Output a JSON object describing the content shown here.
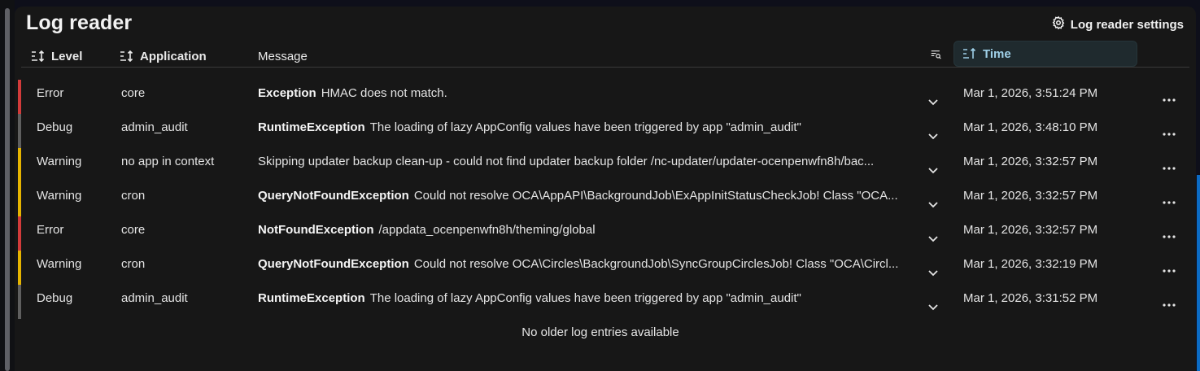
{
  "header": {
    "title": "Log reader",
    "settings_label": "Log reader settings"
  },
  "columns": {
    "level": "Level",
    "application": "Application",
    "message": "Message",
    "time": "Time"
  },
  "colors": {
    "error": "#d23b3b",
    "warning": "#e5b400",
    "debug": "#5f5f5f",
    "accent": "#9fd0e8"
  },
  "rows": [
    {
      "level": "Error",
      "app": "core",
      "exception": "Exception",
      "message": "HMAC does not match.",
      "time": "Mar 1, 2026, 3:51:24 PM"
    },
    {
      "level": "Debug",
      "app": "admin_audit",
      "exception": "RuntimeException",
      "message": "The loading of lazy AppConfig values have been triggered by app \"admin_audit\"",
      "time": "Mar 1, 2026, 3:48:10 PM"
    },
    {
      "level": "Warning",
      "app": "no app in context",
      "exception": "",
      "message": "Skipping updater backup clean-up - could not find updater backup folder /nc-updater/updater-ocenpenwfn8h/bac...",
      "time": "Mar 1, 2026, 3:32:57 PM"
    },
    {
      "level": "Warning",
      "app": "cron",
      "exception": "QueryNotFoundException",
      "message": "Could not resolve OCA\\AppAPI\\BackgroundJob\\ExAppInitStatusCheckJob! Class \"OCA...",
      "time": "Mar 1, 2026, 3:32:57 PM"
    },
    {
      "level": "Error",
      "app": "core",
      "exception": "NotFoundException",
      "message": "/appdata_ocenpenwfn8h/theming/global",
      "time": "Mar 1, 2026, 3:32:57 PM"
    },
    {
      "level": "Warning",
      "app": "cron",
      "exception": "QueryNotFoundException",
      "message": "Could not resolve OCA\\Circles\\BackgroundJob\\SyncGroupCirclesJob! Class \"OCA\\Circl...",
      "time": "Mar 1, 2026, 3:32:19 PM"
    },
    {
      "level": "Debug",
      "app": "admin_audit",
      "exception": "RuntimeException",
      "message": "The loading of lazy AppConfig values have been triggered by app \"admin_audit\"",
      "time": "Mar 1, 2026, 3:31:52 PM"
    }
  ],
  "footer_text": "No older log entries available",
  "icons": {
    "settings": "gear-icon",
    "sort": "sort-icon",
    "filter": "search-filter-icon",
    "expand": "chevron-down-icon",
    "actions": "more-actions-icon"
  }
}
